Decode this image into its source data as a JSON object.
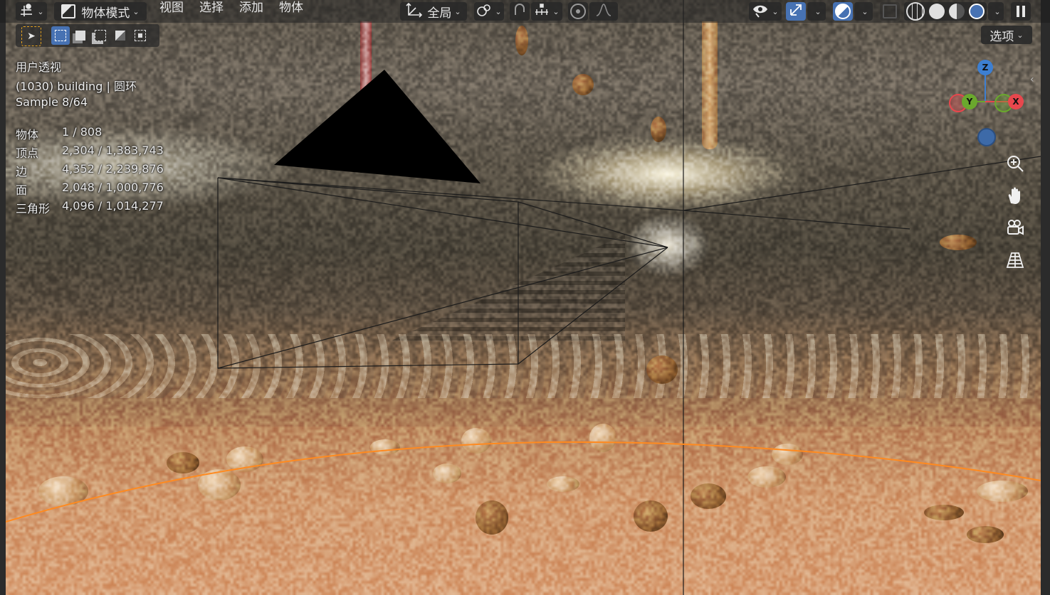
{
  "header": {
    "mode_label": "物体模式",
    "menus": [
      "视图",
      "选择",
      "添加",
      "物体"
    ],
    "transform_orientation": "全局"
  },
  "viewport_info": {
    "view_name": "用户透视",
    "object_info": "(1030) building | 圆环",
    "sample": "Sample 8/64"
  },
  "stats": [
    {
      "label": "物体",
      "value": "1 / 808"
    },
    {
      "label": "顶点",
      "value": "2,304 / 1,383,743"
    },
    {
      "label": "边",
      "value": "4,352 / 2,239,876"
    },
    {
      "label": "面",
      "value": "2,048 / 1,000,776"
    },
    {
      "label": "三角形",
      "value": "4,096 / 1,014,277"
    }
  ],
  "options_label": "选项",
  "gizmo": {
    "z": "Z",
    "y": "Y",
    "x": "X"
  },
  "colors": {
    "header_bg": "#262626",
    "active_blue": "#4772b3",
    "axis_x": "#e8474d",
    "axis_y": "#6aa82d",
    "axis_z": "#3d7fd1",
    "selection_outline": "#ff8a1f",
    "select_box_orange": "#e6a21f"
  },
  "icons": {
    "editor_type": "editor-type-icon",
    "object_mode": "object-mode-icon",
    "transform": "transform-orientation-icon",
    "snap": "snap-icon",
    "proportional": "proportional-editing-icon",
    "visibility": "visibility-icon",
    "gizmo_toggle": "gizmo-toggle-icon",
    "overlay": "overlay-icon",
    "xray": "xray-icon",
    "pause": "pause-render-icon",
    "zoom": "zoom-icon",
    "pan": "hand-icon",
    "camera": "camera-icon",
    "ortho": "grid-perspective-icon"
  }
}
